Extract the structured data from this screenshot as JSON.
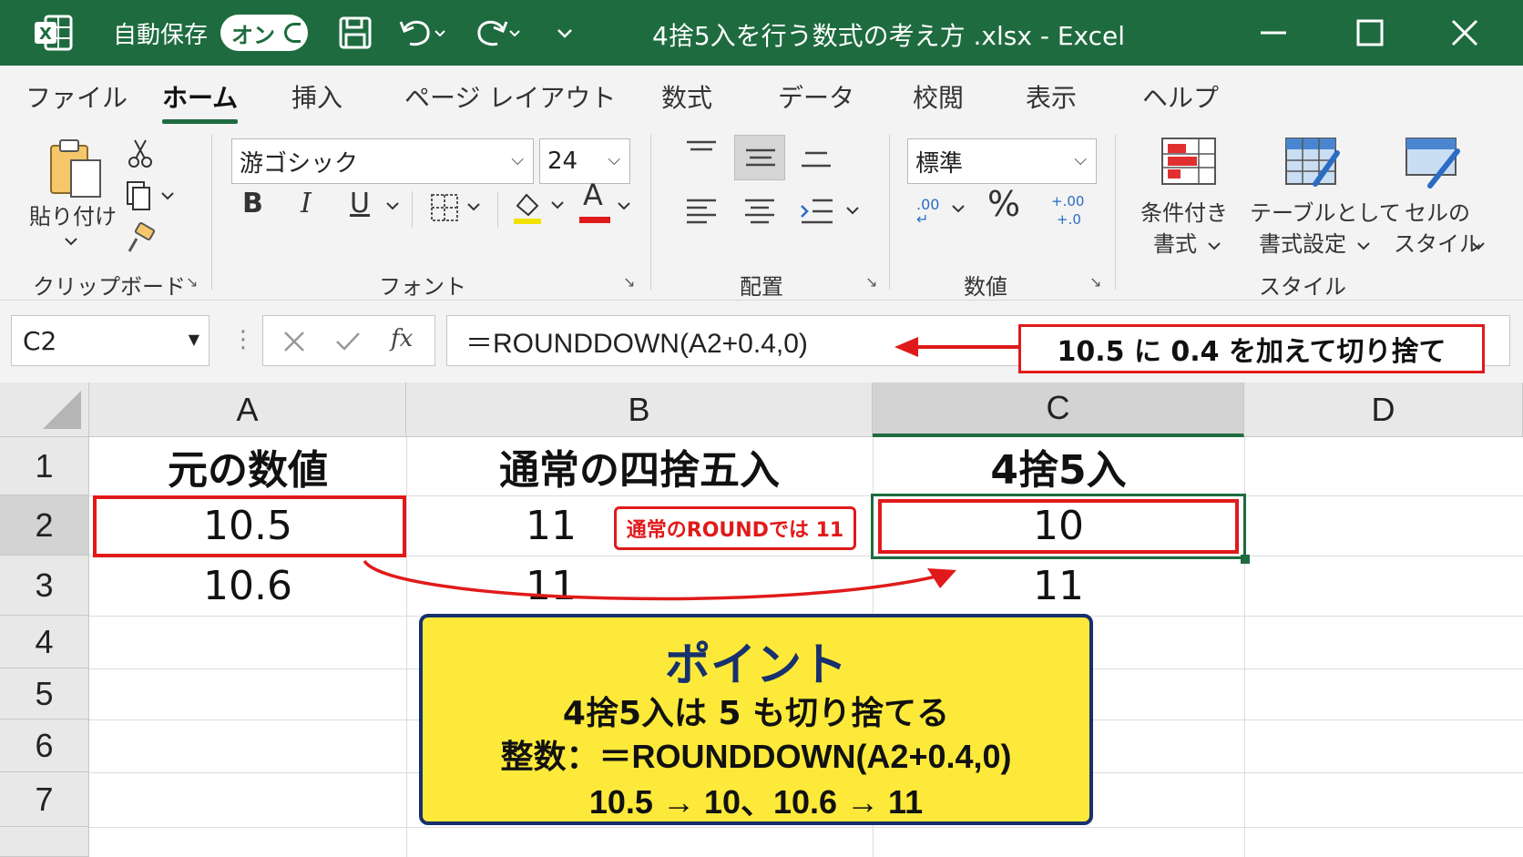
{
  "titlebar": {
    "autosave_label": "自動保存",
    "autosave_state": "オン",
    "title": "4捨5入を行う数式の考え方 .xlsx  -  Excel"
  },
  "menu": {
    "tabs": [
      "ファイル",
      "ホーム",
      "挿入",
      "ページ レイアウト",
      "数式",
      "データ",
      "校閲",
      "表示",
      "ヘルプ"
    ],
    "active": "ホーム"
  },
  "ribbon": {
    "clipboard": {
      "paste_label": "貼り付け",
      "group": "クリップボード"
    },
    "font": {
      "name": "游ゴシック",
      "size": "24",
      "bold": "B",
      "italic": "I",
      "underline": "U",
      "font_color": "A",
      "group": "フォント"
    },
    "alignment": {
      "group": "配置"
    },
    "number": {
      "format": "標準",
      "percent": "%",
      "group": "数値"
    },
    "styles": {
      "conditional_line1": "条件付き",
      "conditional_line2": "書式",
      "table_line1": "テーブルとして",
      "table_line2": "書式設定",
      "cell_line1": "セルの",
      "cell_line2": "スタイル",
      "group": "スタイル"
    }
  },
  "formula_bar": {
    "name_box": "C2",
    "formula": "＝ROUNDDOWN(A2+0.4,0)",
    "annotation": "10.5 に 0.4 を加えて切り捨て"
  },
  "sheet": {
    "columns": [
      "A",
      "B",
      "C",
      "D"
    ],
    "rows": [
      "1",
      "2",
      "3",
      "4",
      "5",
      "6",
      "7"
    ],
    "header": {
      "a": "元の数値",
      "b": "通常の四捨五入",
      "c": "4捨5入"
    },
    "row2": {
      "a": "10.5",
      "b": "11",
      "c": "10"
    },
    "row3": {
      "a": "10.6",
      "b": "11",
      "c": "11"
    },
    "round_note": "通常のROUNDでは 11"
  },
  "point_box": {
    "title": "ポイント",
    "line1": "4捨5入は 5 も切り捨てる",
    "line2": "整数：＝ROUNDDOWN(A2+0.4,0)",
    "line3": "10.5 → 10、10.6 → 11"
  },
  "colors": {
    "excel_green": "#1e6b3f",
    "highlight_red": "#e01a1a",
    "point_yellow": "#fde93a",
    "point_navy": "#17306e"
  }
}
